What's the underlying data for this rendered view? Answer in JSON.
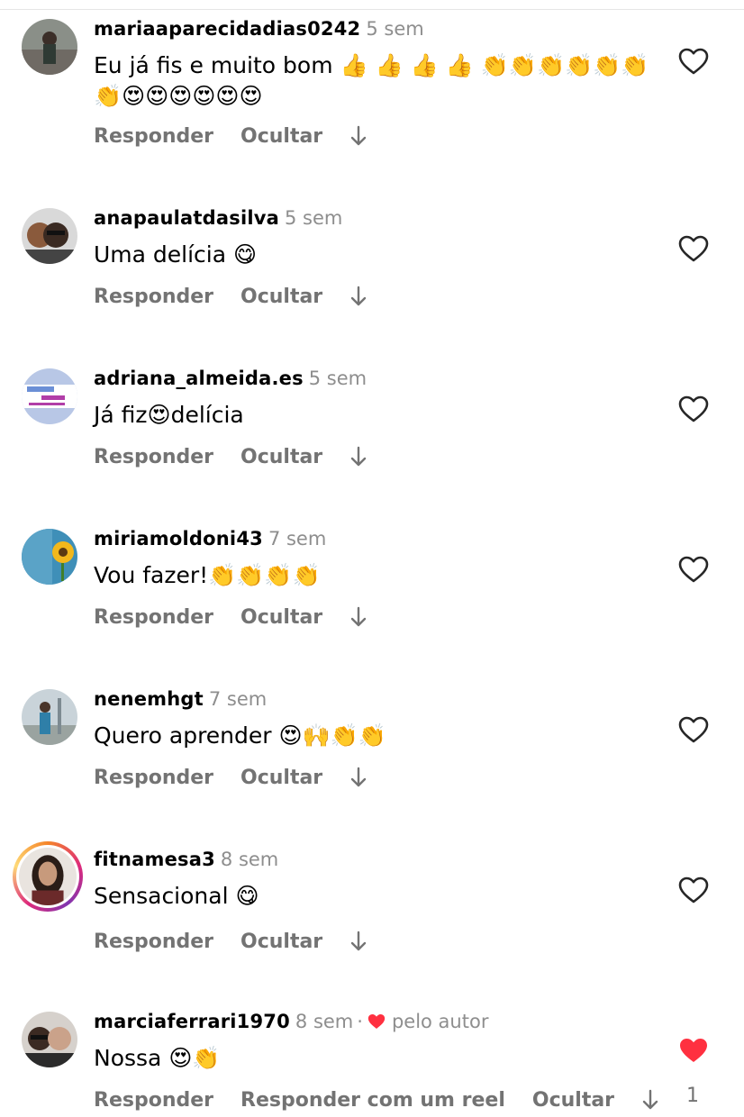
{
  "comments": [
    {
      "username": "mariaaparecidadias0242",
      "time": "5 sem",
      "text": "Eu já fis e muito  bom 👍 👍 👍 👍 👏👏👏👏👏👏👏😍😍😍😍😍😍",
      "actions": [
        "Responder",
        "Ocultar"
      ],
      "liked": false,
      "avatar": "avatar-photo"
    },
    {
      "username": "anapaulatdasilva",
      "time": "5 sem",
      "text": "Uma delícia 😋",
      "actions": [
        "Responder",
        "Ocultar"
      ],
      "liked": false,
      "avatar": "avatar-photo"
    },
    {
      "username": "adriana_almeida.es",
      "time": "5 sem",
      "text": "Já fiz😍delícia",
      "actions": [
        "Responder",
        "Ocultar"
      ],
      "liked": false,
      "avatar": "avatar-logo"
    },
    {
      "username": "miriamoldoni43",
      "time": "7 sem",
      "text": "Vou fazer!👏👏👏👏",
      "actions": [
        "Responder",
        "Ocultar"
      ],
      "liked": false,
      "avatar": "avatar-sunflower"
    },
    {
      "username": "nenemhgt",
      "time": "7 sem",
      "text": "Quero aprender 😍🙌👏👏",
      "actions": [
        "Responder",
        "Ocultar"
      ],
      "liked": false,
      "avatar": "avatar-photo"
    },
    {
      "username": "fitnamesa3",
      "time": "8 sem",
      "text": "Sensacional 😋",
      "actions": [
        "Responder",
        "Ocultar"
      ],
      "liked": false,
      "avatar": "avatar-story-ring"
    },
    {
      "username": "marciaferrari1970",
      "time": "8 sem",
      "separator": "·",
      "author_like": "pelo autor",
      "text": "Nossa 😍👏",
      "actions": [
        "Responder",
        "Responder com um reel",
        "Ocultar"
      ],
      "liked": true,
      "like_count": "1",
      "avatar": "avatar-photo"
    }
  ],
  "colors": {
    "like_red": "#ff3040",
    "muted": "#737373",
    "time": "#8e8e8e"
  }
}
